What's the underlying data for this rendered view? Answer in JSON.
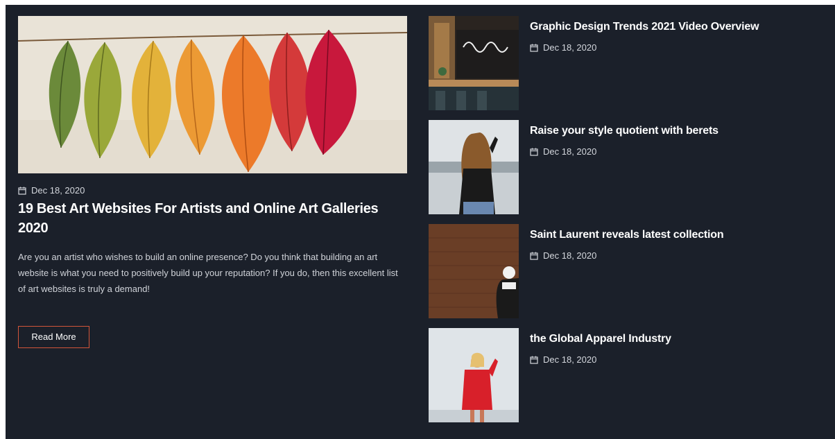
{
  "featured": {
    "date": "Dec 18, 2020",
    "title": "19 Best Art Websites For Artists and Online Art Galleries 2020",
    "excerpt": "Are you an artist who wishes to build an online presence? Do you think that building an art website is what you need to positively build up your reputation? If you do, then this excellent list of art websites is truly a demand!",
    "read_more_label": "Read More",
    "accent_color": "#d2553a"
  },
  "side_posts": [
    {
      "title": "Graphic Design Trends 2021 Video Overview",
      "date": "Dec 18, 2020"
    },
    {
      "title": "Raise your style quotient with berets",
      "date": "Dec 18, 2020"
    },
    {
      "title": "Saint Laurent reveals latest collection",
      "date": "Dec 18, 2020"
    },
    {
      "title": "the Global Apparel Industry",
      "date": "Dec 18, 2020"
    }
  ],
  "icons": {
    "date": "calendar-icon"
  },
  "colors": {
    "background": "#1b202a",
    "text": "#ffffff",
    "meta_text": "#d4d7dd"
  }
}
